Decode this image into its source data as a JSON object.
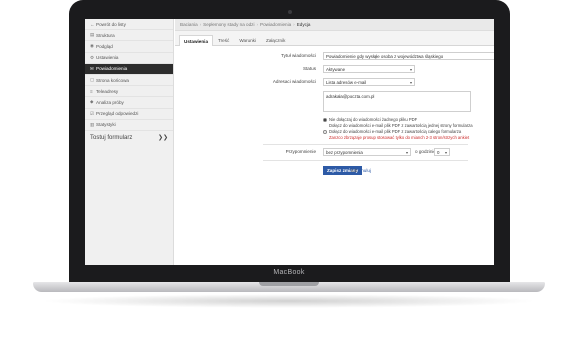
{
  "device": {
    "brand": "MacBook"
  },
  "sidebar": {
    "items": [
      {
        "icon": "back-arrow-icon",
        "glyph": "←",
        "label": "Powrót do listy"
      },
      {
        "icon": "structure-icon",
        "glyph": "▤",
        "label": "Struktura"
      },
      {
        "icon": "eye-icon",
        "glyph": "◉",
        "label": "Podgląd"
      },
      {
        "icon": "gear-icon",
        "glyph": "⚙",
        "label": "Ustawienia"
      },
      {
        "icon": "envelope-icon",
        "glyph": "✉",
        "label": "Powiadomienia",
        "active": true
      },
      {
        "icon": "document-icon",
        "glyph": "▢",
        "label": "Strona końcowa"
      },
      {
        "icon": "bars-icon",
        "glyph": "≡",
        "label": "Teleadresy"
      },
      {
        "icon": "bug-icon",
        "glyph": "◆",
        "label": "Analiza próby"
      },
      {
        "icon": "checkbox-icon",
        "glyph": "☑",
        "label": "Przegląd odpowiedzi"
      },
      {
        "icon": "chart-icon",
        "glyph": "▥",
        "label": "Statystyki"
      }
    ],
    "footer_label": "Tostuj formularz",
    "footer_chevron": "❯❯"
  },
  "breadcrumbs": [
    "Baciania",
    "Sepłemony stady na odzi",
    "Powiadomienia",
    "Edycja"
  ],
  "tabs": [
    "Ustawienia",
    "Treść",
    "Warunki",
    "Załącznik"
  ],
  "form": {
    "title_label": "Tytuł wiadomości",
    "title_value": "Powiadomienie gdy wysłąłe osoba z województwa śląskiego",
    "status_label": "Status",
    "status_value": "Aktywane",
    "address_label": "Adresaci wiadomości",
    "address_value": "Lista adresów e-mail",
    "address_list": "adrakała@poczta.com.pl",
    "radio_options": [
      "Nie dołączaj do wiadomości żadnego pliku PDF",
      "Dołącz do wiadomości e-mail plik PDF z zawartością jednej strony formularza",
      "Dołącz do wiadomości e-mail plik PDF z zawartością całego formularza"
    ],
    "warning": "Zanzco zbrzązaje prosup stosować tylko do mianch 2-3 stron/strzych ankiet",
    "reminder_label": "Przypomnienie",
    "reminder_value": "bez przypomnienia",
    "reminder_after": "o godzinie",
    "reminder_hour": "0",
    "save_label": "Zapisz zmiany",
    "cancel_prefix": "lub",
    "cancel_link": "Anuluj"
  }
}
